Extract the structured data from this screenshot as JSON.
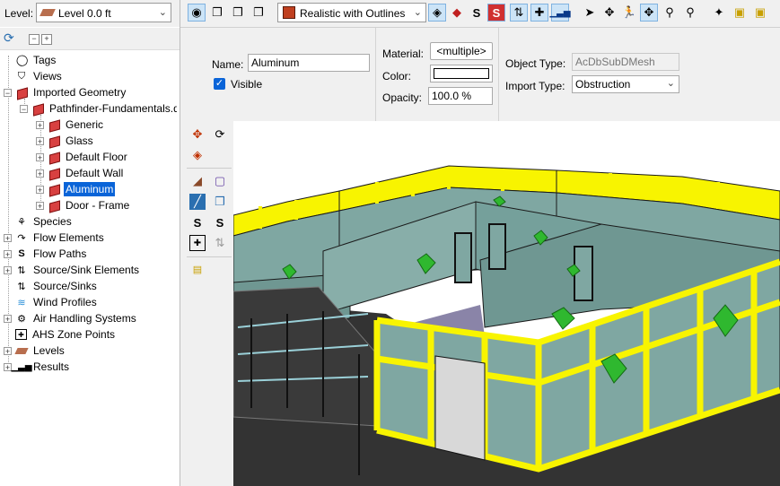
{
  "level_bar": {
    "label": "Level:",
    "selected": "Level 0.0 ft"
  },
  "tree": {
    "items": [
      {
        "label": "Tags",
        "icon": "tag-icon"
      },
      {
        "label": "Views",
        "icon": "camera-icon"
      },
      {
        "label": "Imported Geometry",
        "icon": "geometry-icon"
      },
      {
        "label": "Pathfinder-Fundamentals.dwg",
        "icon": "geometry-icon"
      },
      {
        "label": "Generic",
        "icon": "geometry-icon"
      },
      {
        "label": "Glass",
        "icon": "geometry-icon"
      },
      {
        "label": "Default Floor",
        "icon": "geometry-icon"
      },
      {
        "label": "Default Wall",
        "icon": "geometry-icon"
      },
      {
        "label": "Aluminum",
        "icon": "geometry-icon"
      },
      {
        "label": "Door - Frame",
        "icon": "geometry-icon"
      },
      {
        "label": "Species",
        "icon": "species-icon"
      },
      {
        "label": "Flow Elements",
        "icon": "flow-elements-icon"
      },
      {
        "label": "Flow Paths",
        "icon": "flow-paths-icon"
      },
      {
        "label": "Source/Sink Elements",
        "icon": "source-sink-elements-icon"
      },
      {
        "label": "Source/Sinks",
        "icon": "source-sinks-icon"
      },
      {
        "label": "Wind Profiles",
        "icon": "wind-icon"
      },
      {
        "label": "Air Handling Systems",
        "icon": "ahs-icon"
      },
      {
        "label": "AHS Zone Points",
        "icon": "ahs-zone-icon"
      },
      {
        "label": "Levels",
        "icon": "level-icon"
      },
      {
        "label": "Results",
        "icon": "results-chart-icon"
      }
    ],
    "selected_label": "Aluminum"
  },
  "toolbar": {
    "render_mode": "Realistic with Outlines"
  },
  "properties": {
    "name_label": "Name:",
    "name_value": "Aluminum",
    "visible_label": "Visible",
    "material_label": "Material:",
    "material_value": "<multiple>",
    "color_label": "Color:",
    "opacity_label": "Opacity:",
    "opacity_value": "100.0 %",
    "object_type_label": "Object Type:",
    "object_type_value": "AcDbSubDMesh",
    "import_type_label": "Import Type:",
    "import_type_value": "Obstruction"
  },
  "colors": {
    "selection": "#0a64d8",
    "outline_highlight": "#ffff00",
    "wall": "#7fa7a2",
    "floor": "#333333",
    "occupant_marker": "#2fb82f"
  }
}
